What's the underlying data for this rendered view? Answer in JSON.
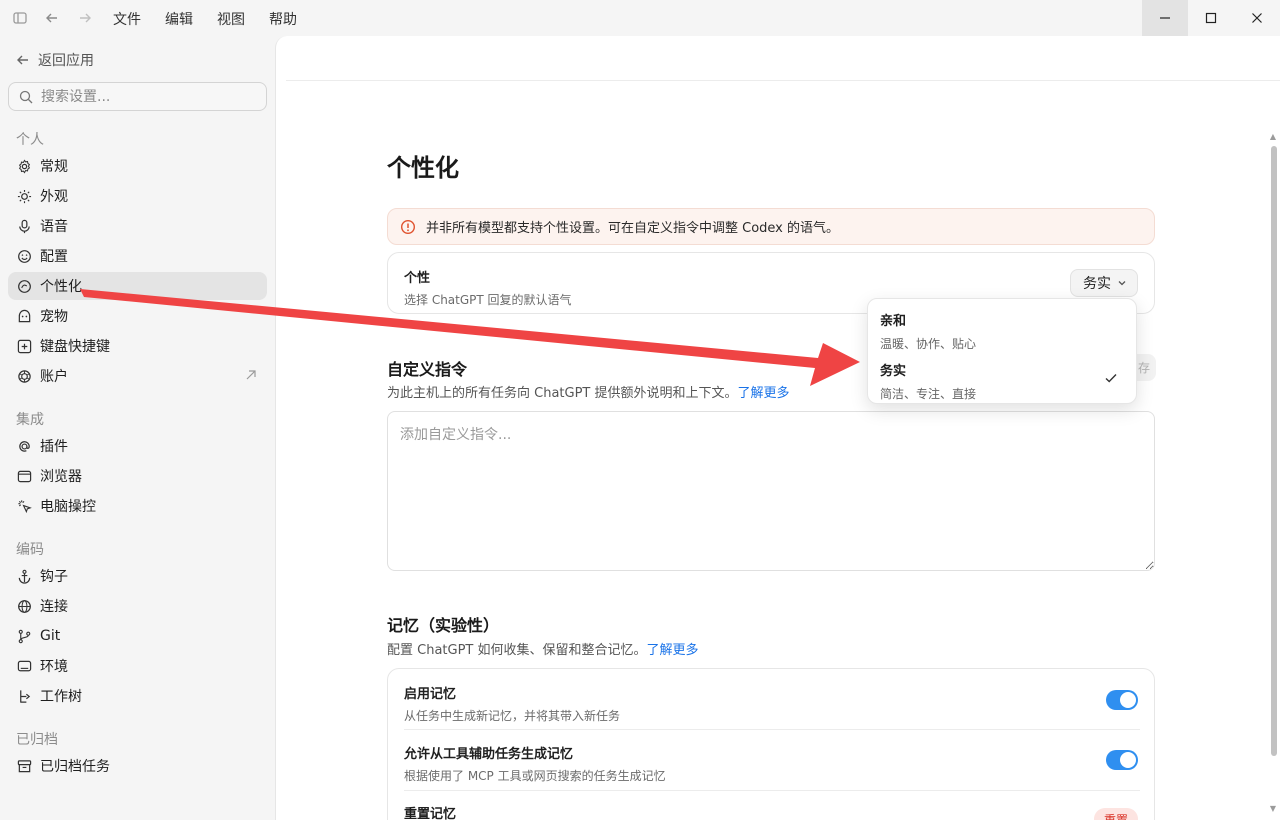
{
  "menu": [
    "文件",
    "编辑",
    "视图",
    "帮助"
  ],
  "sidebar": {
    "back_label": "返回应用",
    "search_placeholder": "搜索设置...",
    "sections": [
      {
        "label": "个人",
        "items": [
          {
            "label": "常规",
            "icon": "gear-icon"
          },
          {
            "label": "外观",
            "icon": "sun-icon"
          },
          {
            "label": "语音",
            "icon": "mic-icon"
          },
          {
            "label": "配置",
            "icon": "smile-icon"
          },
          {
            "label": "个性化",
            "icon": "personalize-icon",
            "selected": true
          },
          {
            "label": "宠物",
            "icon": "pet-icon"
          },
          {
            "label": "键盘快捷键",
            "icon": "keyboard-icon"
          },
          {
            "label": "账户",
            "icon": "openai-icon",
            "external": true
          }
        ]
      },
      {
        "label": "集成",
        "items": [
          {
            "label": "插件",
            "icon": "at-icon"
          },
          {
            "label": "浏览器",
            "icon": "browser-icon"
          },
          {
            "label": "电脑操控",
            "icon": "cursor-icon"
          }
        ]
      },
      {
        "label": "编码",
        "items": [
          {
            "label": "钩子",
            "icon": "anchor-icon"
          },
          {
            "label": "连接",
            "icon": "globe-icon"
          },
          {
            "label": "Git",
            "icon": "git-branch-icon"
          },
          {
            "label": "环境",
            "icon": "monitor-icon"
          },
          {
            "label": "工作树",
            "icon": "tree-icon"
          }
        ]
      },
      {
        "label": "已归档",
        "items": [
          {
            "label": "已归档任务",
            "icon": "archive-icon"
          }
        ]
      }
    ]
  },
  "main": {
    "title": "个性化",
    "banner": "并非所有模型都支持个性设置。可在自定义指令中调整 Codex 的语气。",
    "personality": {
      "title": "个性",
      "subtitle": "选择 ChatGPT 回复的默认语气",
      "selected": "务实"
    },
    "custom": {
      "title": "自定义指令",
      "desc": "为此主机上的所有任务向 ChatGPT 提供额外说明和上下文。",
      "link": "了解更多",
      "placeholder": "添加自定义指令...",
      "save_peek": "存"
    },
    "memory": {
      "title": "记忆（实验性）",
      "desc": "配置 ChatGPT 如何收集、保留和整合记忆。",
      "link": "了解更多",
      "rows": [
        {
          "title": "启用记忆",
          "subtitle": "从任务中生成新记忆，并将其带入新任务",
          "enabled": true
        },
        {
          "title": "允许从工具辅助任务生成记忆",
          "subtitle": "根据使用了 MCP 工具或网页搜索的任务生成记忆",
          "enabled": true
        }
      ],
      "reset_title": "重置记忆",
      "reset_button": "重置"
    }
  },
  "popover": {
    "options": [
      {
        "title": "亲和",
        "subtitle": "温暖、协作、贴心",
        "checked": false
      },
      {
        "title": "务实",
        "subtitle": "简洁、专注、直接",
        "checked": true
      }
    ]
  },
  "colors": {
    "accent": "#2f8ff0",
    "link": "#1a73e8",
    "arrow": "#ef4444"
  }
}
